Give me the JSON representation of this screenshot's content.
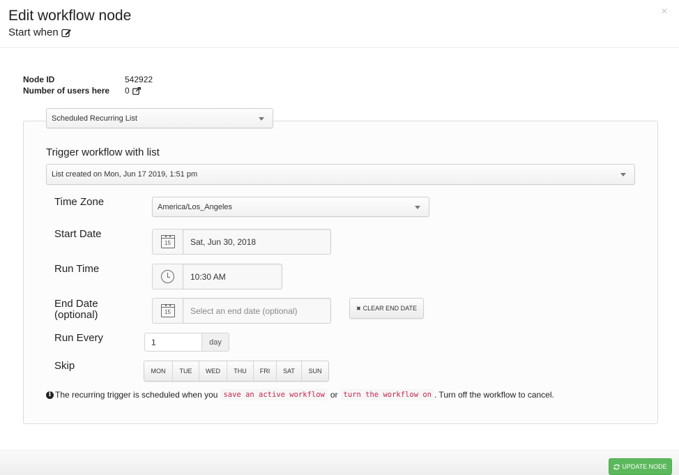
{
  "header": {
    "title": "Edit workflow node",
    "subtitle": "Start when",
    "subtitle_icon": "edit-icon",
    "close_icon": "close-icon",
    "close_glyph": "×"
  },
  "info": {
    "node_id_label": "Node ID",
    "node_id_value": "542922",
    "users_label": "Number of users here",
    "users_value": "0",
    "users_icon": "external-link-icon"
  },
  "trigger_type": {
    "selected": "Scheduled Recurring List"
  },
  "trigger_list": {
    "heading": "Trigger workflow with list",
    "selected": "List created on Mon, Jun 17 2019, 1:51 pm"
  },
  "fields": {
    "time_zone": {
      "label": "Time Zone",
      "value": "America/Los_Angeles"
    },
    "start_date": {
      "label": "Start Date",
      "value": "Sat, Jun 30, 2018",
      "icon": "calendar-icon",
      "icon_text": "15"
    },
    "run_time": {
      "label": "Run Time",
      "value": "10:30 AM",
      "icon": "clock-icon"
    },
    "end_date": {
      "label_line1": "End Date",
      "label_line2": "(optional)",
      "placeholder": "Select an end date (optional)",
      "value": "",
      "icon": "calendar-icon",
      "icon_text": "15"
    },
    "clear_end_date": {
      "label": "CLEAR END DATE",
      "icon": "times-icon",
      "glyph": "✖"
    },
    "run_every": {
      "label": "Run Every",
      "value": "1",
      "unit": "day"
    },
    "skip": {
      "label": "Skip",
      "days": [
        "MON",
        "TUE",
        "WED",
        "THU",
        "FRI",
        "SAT",
        "SUN"
      ]
    }
  },
  "note": {
    "icon": "info-circle-icon",
    "icon_glyph": "i",
    "text_1": "The recurring trigger is scheduled when you",
    "code_1": "save an active workflow",
    "text_2": "or",
    "code_2": "turn the workflow on",
    "text_3": ". Turn off the workflow to cancel."
  },
  "footer": {
    "update_button": "UPDATE NODE",
    "update_icon": "refresh-icon",
    "update_color": "#5cb85c"
  }
}
